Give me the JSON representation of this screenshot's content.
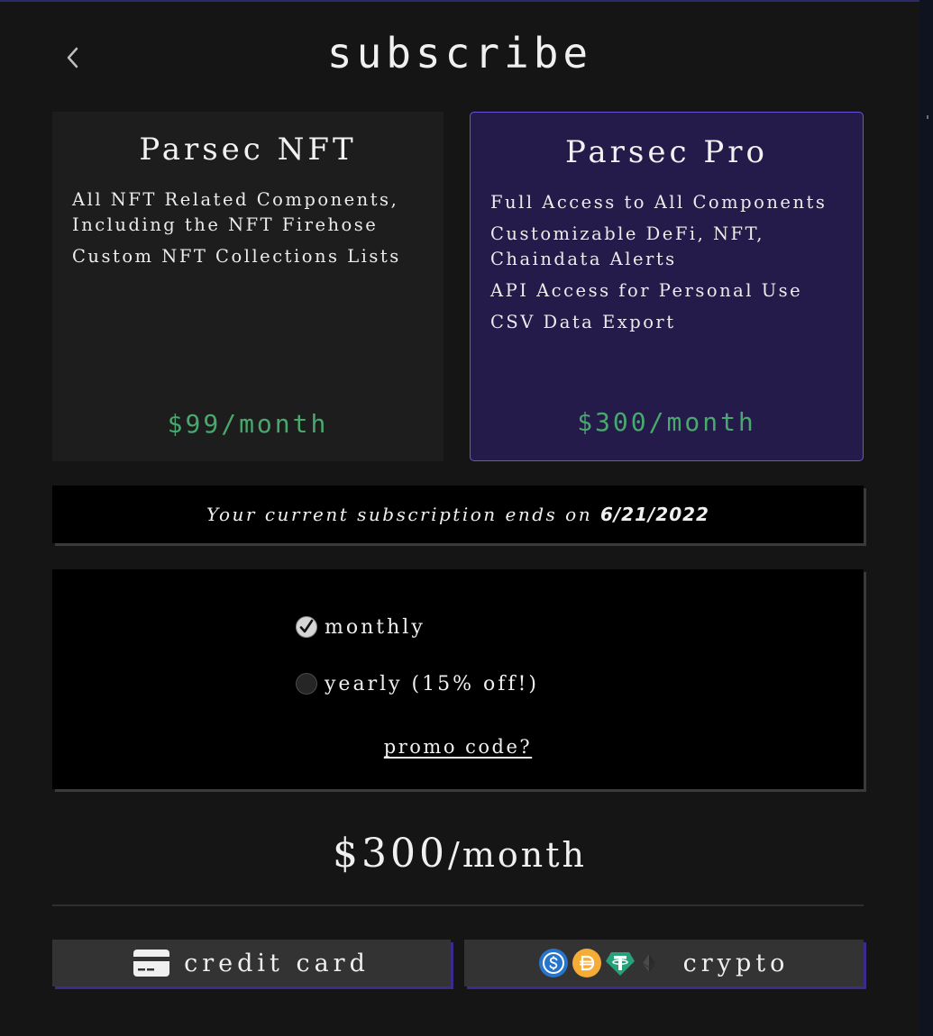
{
  "page": {
    "title": "subscribe"
  },
  "plans": [
    {
      "name": "Parsec NFT",
      "features": [
        "All NFT Related Components, Including the NFT Firehose",
        "Custom NFT Collections Lists"
      ],
      "price": "$99/month",
      "selected": false
    },
    {
      "name": "Parsec Pro",
      "features": [
        "Full Access to All Components",
        "Customizable DeFi, NFT, Chaindata Alerts",
        "API Access for Personal Use",
        "CSV Data Export"
      ],
      "price": "$300/month",
      "selected": true
    }
  ],
  "notice": {
    "text": "Your current subscription ends on ",
    "date": "6/21/2022"
  },
  "billing": {
    "options": [
      {
        "label": "monthly",
        "checked": true
      },
      {
        "label": "yearly (15% off!)",
        "checked": false
      }
    ],
    "promo": "promo code?"
  },
  "total": {
    "amount": "$300",
    "period": "/month"
  },
  "payment": {
    "card_label": "credit card",
    "crypto_label": "crypto",
    "crypto_icons": [
      "usdc-icon",
      "dai-icon",
      "tether-icon",
      "ethereum-icon"
    ]
  },
  "colors": {
    "background": "#151515",
    "price_green": "#49a86d",
    "selected_plan_bg": "#251b4a",
    "selected_plan_border": "#6b52d8",
    "accent_shadow": "#3a2c8c"
  }
}
